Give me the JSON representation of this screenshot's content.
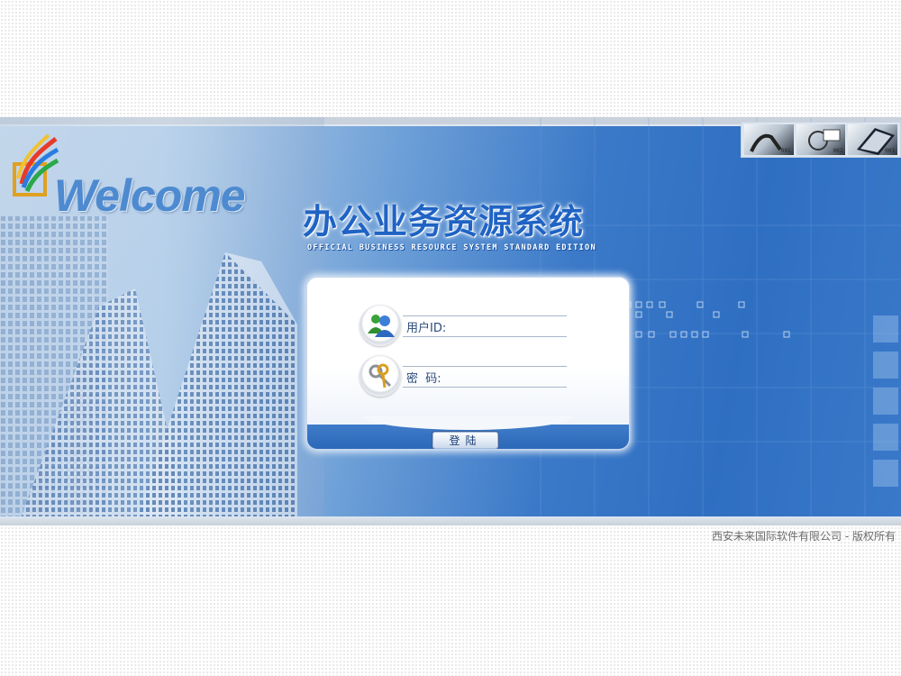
{
  "banner": {
    "welcome_text": "Welcome",
    "app_title": "办公业务资源系统",
    "app_subtitle": "OFFICIAL BUSINESS RESOURCE SYSTEM STANDARD EDITION",
    "thumbnails": [
      {
        "label": "001",
        "icon": "handshake-photo"
      },
      {
        "label": "002",
        "icon": "calculator-photo"
      },
      {
        "label": "003",
        "icon": "laptop-photo"
      }
    ]
  },
  "login": {
    "user_id_label": "用户ID:",
    "user_id_value": "",
    "password_label": "密  码:",
    "password_value": "",
    "submit_label": "登陆",
    "user_icon": "users-icon",
    "password_icon": "keys-icon"
  },
  "footer": {
    "copyright": "西安未来国际软件有限公司 - 版权所有"
  },
  "colors": {
    "banner_blue": "#2f6fc2",
    "title_blue": "#1f63c4",
    "welcome_blue": "#4d8ad0"
  }
}
